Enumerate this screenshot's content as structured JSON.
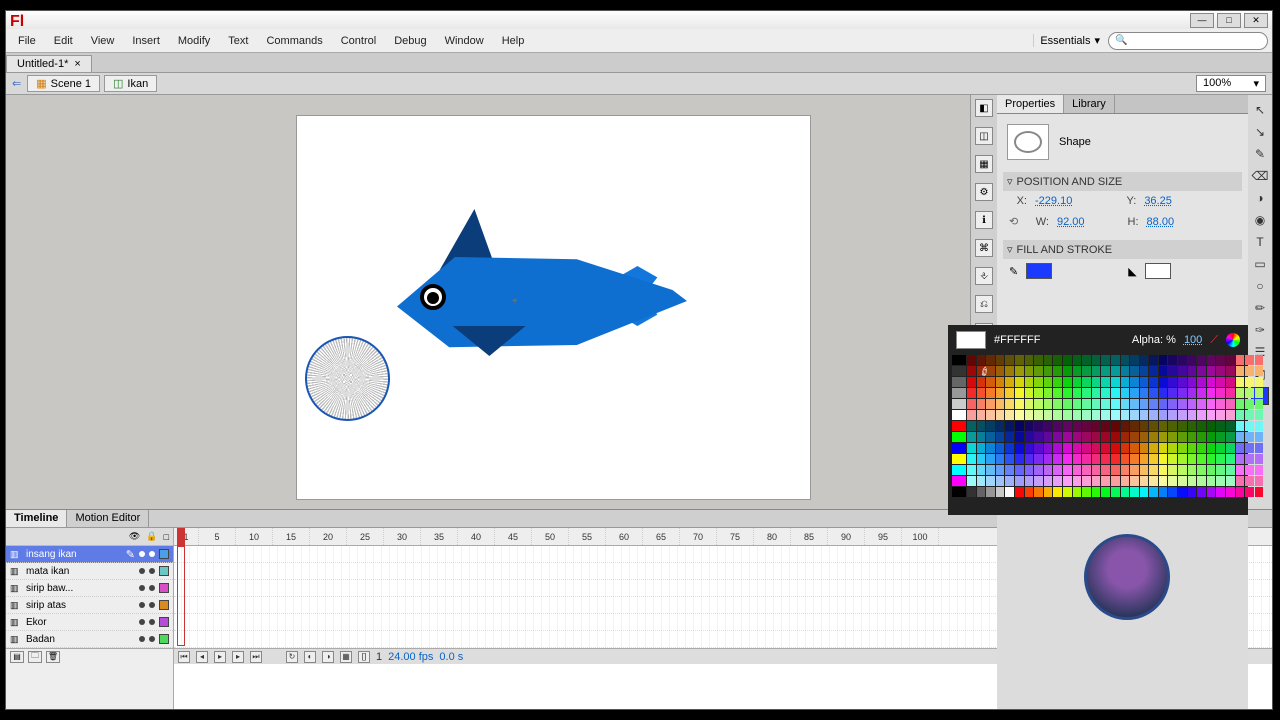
{
  "window": {
    "title": "Untitled-1*"
  },
  "menus": [
    "File",
    "Edit",
    "View",
    "Insert",
    "Modify",
    "Text",
    "Commands",
    "Control",
    "Debug",
    "Window",
    "Help"
  ],
  "workspace_selector": "Essentials",
  "search": {
    "placeholder": ""
  },
  "doc_tabs": [
    {
      "label": "Untitled-1*",
      "close": "×"
    }
  ],
  "breadcrumb": {
    "back": "⇐",
    "scene": "Scene 1",
    "icon_label": "Ikan"
  },
  "zoom": "100%",
  "panels": {
    "tabs": [
      "Properties",
      "Library"
    ],
    "shape_label": "Shape",
    "sections": {
      "pos": "POSITION AND SIZE",
      "fill": "FILL AND STROKE"
    },
    "x_label": "X:",
    "x_val": "-229.10",
    "y_label": "Y:",
    "y_val": "36.25",
    "w_label": "W:",
    "w_val": "92.00",
    "h_label": "H:",
    "h_val": "88.00",
    "fill_hex": "#FFFFFF",
    "alpha_label": "Alpha: %",
    "alpha_val": "100"
  },
  "timeline": {
    "tabs": [
      "Timeline",
      "Motion Editor"
    ],
    "ruler": [
      "1",
      "5",
      "10",
      "15",
      "20",
      "25",
      "30",
      "35",
      "40",
      "45",
      "50",
      "55",
      "60",
      "65",
      "70",
      "75",
      "80",
      "85",
      "90",
      "95",
      "100"
    ],
    "layers": [
      {
        "name": "insang ikan",
        "color": "#4aa0e6",
        "active": true
      },
      {
        "name": "mata ikan",
        "color": "#6cc6c6"
      },
      {
        "name": "sirip baw...",
        "color": "#d94fc7"
      },
      {
        "name": "sirip atas",
        "color": "#d98b1f"
      },
      {
        "name": "Ekor",
        "color": "#b44fd9"
      },
      {
        "name": "Badan",
        "color": "#4fd95a"
      }
    ],
    "status": {
      "frame": "1",
      "fps": "24.00 fps",
      "time": "0.0 s"
    }
  },
  "icons": {
    "min": "—",
    "max": "□",
    "close": "✕",
    "arrow": "▾",
    "mag": "🔍",
    "ruler_vert": [
      "◧",
      "◫",
      "▦",
      "⚙",
      "ℹ",
      "⌘",
      "⎀",
      "⎌",
      "☼"
    ],
    "tools": [
      "↖",
      "↘",
      "✎",
      "⌫",
      "◑",
      "◉",
      "T",
      "▭",
      "○",
      "✏",
      "✑",
      "☰",
      "◩"
    ]
  }
}
